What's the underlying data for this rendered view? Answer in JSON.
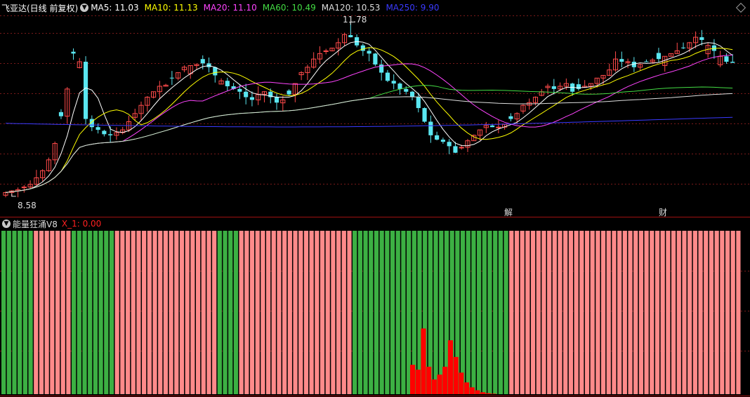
{
  "main_header": {
    "stock_title": "飞亚达(日线 前复权)",
    "ma_items": [
      {
        "text": "MA5: 11.03",
        "color": "#ffffff"
      },
      {
        "text": "MA10: 11.13",
        "color": "#ffff00"
      },
      {
        "text": "MA20: 11.10",
        "color": "#ff44ff"
      },
      {
        "text": "MA60: 10.49",
        "color": "#44dd44"
      },
      {
        "text": "MA120: 10.53",
        "color": "#dddddd"
      },
      {
        "text": "MA250: 9.90",
        "color": "#3a3aff"
      }
    ]
  },
  "annotations": {
    "high_price": "11.78",
    "low_price": "8.58",
    "marker_1": "解",
    "marker_2": "财"
  },
  "indicator_header": {
    "name": "能量狂涌V8",
    "x1_text": "X_1: 0.00"
  },
  "colors": {
    "up": "#ff4a4a",
    "down": "#5ae6f0",
    "grid": "#7a1a1a",
    "divider": "#a01010",
    "bar_green": "#3cb043",
    "bar_pink": "#ff8a8a",
    "energy": "#ff0000"
  },
  "chart_data": [
    {
      "type": "line",
      "title": "飞亚达(日线 前复权)",
      "series": [
        {
          "name": "MA5",
          "last": 11.03
        },
        {
          "name": "MA10",
          "last": 11.13
        },
        {
          "name": "MA20",
          "last": 11.1
        },
        {
          "name": "MA60",
          "last": 10.49
        },
        {
          "name": "MA120",
          "last": 10.53
        },
        {
          "name": "MA250",
          "last": 9.9
        }
      ],
      "highest": 11.78,
      "lowest": 8.58,
      "close_path": [
        8.65,
        8.68,
        8.7,
        8.75,
        8.8,
        8.92,
        9.05,
        9.25,
        9.55,
        10.05,
        10.55,
        11.2,
        11.05,
        10.0,
        9.85,
        9.8,
        9.72,
        9.7,
        9.75,
        9.8,
        9.95,
        10.1,
        10.25,
        10.4,
        10.5,
        10.6,
        10.62,
        10.75,
        10.85,
        10.95,
        10.98,
        11.0,
        11.02,
        10.95,
        10.8,
        10.7,
        10.6,
        10.55,
        10.5,
        10.4,
        10.35,
        10.45,
        10.5,
        10.4,
        10.3,
        10.35,
        10.45,
        10.65,
        10.85,
        10.95,
        11.1,
        11.2,
        11.25,
        11.3,
        11.4,
        11.55,
        11.5,
        11.35,
        11.25,
        11.2,
        11.0,
        10.85,
        10.7,
        10.65,
        10.55,
        10.5,
        10.4,
        10.2,
        9.95,
        9.7,
        9.62,
        9.58,
        9.5,
        9.38,
        9.48,
        9.6,
        9.7,
        9.8,
        9.88,
        9.85,
        9.85,
        9.9,
        10.0,
        10.1,
        10.25,
        10.3,
        10.4,
        10.5,
        10.6,
        10.55,
        10.6,
        10.65,
        10.5,
        10.55,
        10.6,
        10.65,
        10.75,
        10.8,
        10.9,
        11.1,
        11.05,
        11.05,
        10.95,
        11.0,
        11.05,
        11.08,
        11.1,
        11.15,
        11.2,
        11.25,
        11.3,
        11.4,
        11.5,
        11.45,
        11.35,
        11.25,
        11.15,
        11.05,
        11.03
      ]
    },
    {
      "type": "bar",
      "title": "能量狂涌V8",
      "series": [
        {
          "name": "X_1",
          "last": 0.0
        }
      ],
      "status_colors": [
        "g",
        "g",
        "g",
        "g",
        "g",
        "g",
        "p",
        "p",
        "p",
        "p",
        "p",
        "p",
        "p",
        "g",
        "g",
        "g",
        "g",
        "g",
        "g",
        "g",
        "g",
        "p",
        "p",
        "p",
        "p",
        "p",
        "p",
        "p",
        "p",
        "p",
        "p",
        "p",
        "p",
        "p",
        "p",
        "p",
        "p",
        "p",
        "p",
        "p",
        "g",
        "g",
        "g",
        "g",
        "p",
        "p",
        "p",
        "p",
        "p",
        "p",
        "p",
        "p",
        "p",
        "p",
        "p",
        "p",
        "p",
        "p",
        "p",
        "p",
        "p",
        "p",
        "p",
        "p",
        "p",
        "g",
        "g",
        "g",
        "g",
        "g",
        "g",
        "g",
        "g",
        "g",
        "g",
        "g",
        "g",
        "g",
        "g",
        "g",
        "g",
        "g",
        "g",
        "g",
        "g",
        "g",
        "g",
        "g",
        "g",
        "g",
        "g",
        "g",
        "g",
        "g",
        "p",
        "p",
        "p",
        "p",
        "p",
        "p",
        "p",
        "p",
        "p",
        "p",
        "p",
        "p",
        "p",
        "p",
        "p",
        "p",
        "p",
        "p",
        "p",
        "p",
        "p",
        "p",
        "p",
        "p",
        "p",
        "p",
        "p",
        "p",
        "p",
        "p",
        "p",
        "p",
        "p",
        "p",
        "p",
        "p",
        "p",
        "p",
        "p",
        "p",
        "p",
        "p",
        "p"
      ],
      "energy_values": [
        0.3,
        0.25,
        0.67,
        0.28,
        0.15,
        0.2,
        0.28,
        0.55,
        0.38,
        0.22,
        0.12,
        0.07,
        0.04,
        0.02,
        0.01,
        0.005
      ]
    }
  ]
}
